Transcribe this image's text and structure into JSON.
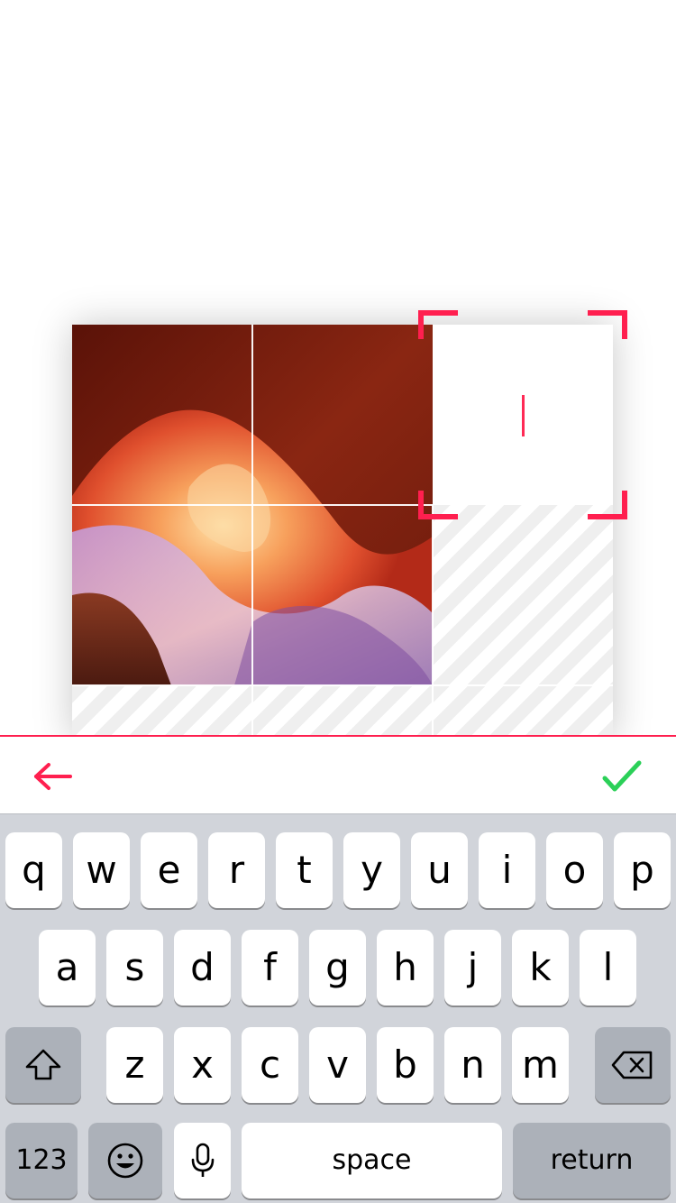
{
  "canvas": {
    "photo": {
      "description_icon": "canyon-photo"
    },
    "text_cell": {
      "caret_color": "#ff2a55"
    }
  },
  "colors": {
    "accent": "#ff1f4f",
    "confirm": "#2bd058",
    "keyboard_bg": "#d1d4da"
  },
  "toolbar": {
    "back_icon": "arrow-left-icon",
    "done_icon": "checkmark-icon"
  },
  "keyboard": {
    "row1": [
      "q",
      "w",
      "e",
      "r",
      "t",
      "y",
      "u",
      "i",
      "o",
      "p"
    ],
    "row2": [
      "a",
      "s",
      "d",
      "f",
      "g",
      "h",
      "j",
      "k",
      "l"
    ],
    "row3": [
      "z",
      "x",
      "c",
      "v",
      "b",
      "n",
      "m"
    ],
    "shift_icon": "shift-icon",
    "delete_icon": "delete-icon",
    "numbers_label": "123",
    "emoji_icon": "emoji-icon",
    "mic_icon": "microphone-icon",
    "space_label": "space",
    "return_label": "return"
  }
}
